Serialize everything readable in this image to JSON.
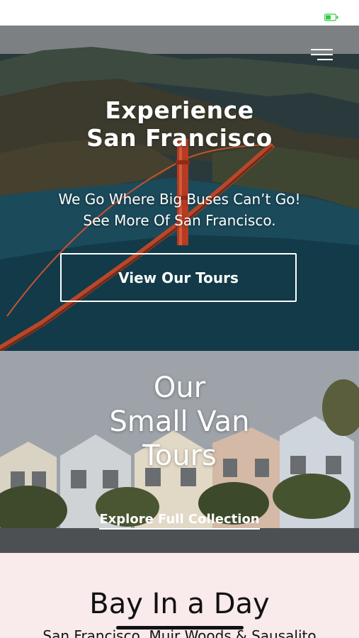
{
  "status_bar": {
    "battery_icon": "battery-icon",
    "battery_color": "#2ecc40"
  },
  "nav": {
    "menu_icon": "hamburger-menu-icon"
  },
  "hero": {
    "title_line1": "Experience",
    "title_line2": "San Francisco",
    "subtitle_line1": "We Go Where Big Buses Can’t Go!",
    "subtitle_line2": "See More Of San Francisco.",
    "button_label": "View Our Tours",
    "image": "golden-gate-bridge-aerial-photo"
  },
  "tours": {
    "title_line1": "Our",
    "title_line2": "Small Van",
    "title_line3": "Tours",
    "link_label": "Explore Full Collection",
    "image": "painted-ladies-houses-photo"
  },
  "bay": {
    "title": "Bay In a Day",
    "subtitle": "San Francisco, Muir Woods & Sausalito",
    "background": "#f9eaec"
  }
}
